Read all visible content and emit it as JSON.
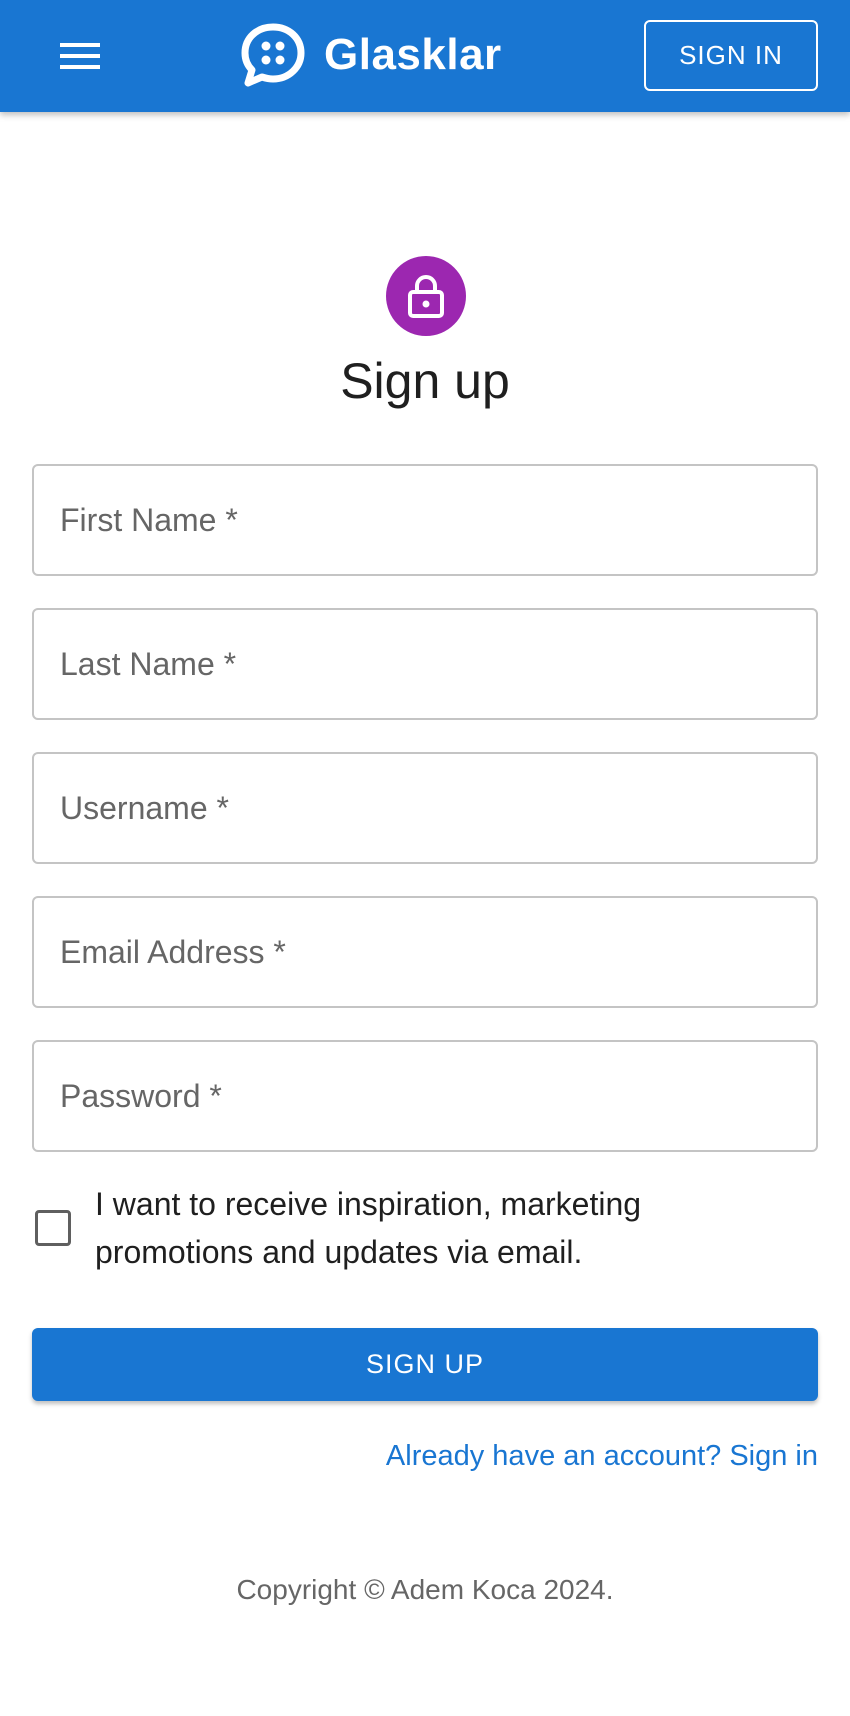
{
  "header": {
    "brand_name": "Glasklar",
    "signin_label": "SIGN IN",
    "menu_icon": "hamburger-menu-icon",
    "logo_icon": "chat-bubble-logo-icon",
    "color": "#1976d2"
  },
  "form": {
    "avatar_icon": "lock-icon",
    "avatar_color": "#9c27b0",
    "title": "Sign up",
    "fields": {
      "first_name": {
        "placeholder": "First Name *",
        "value": ""
      },
      "last_name": {
        "placeholder": "Last Name *",
        "value": ""
      },
      "username": {
        "placeholder": "Username *",
        "value": ""
      },
      "email": {
        "placeholder": "Email Address *",
        "value": ""
      },
      "password": {
        "placeholder": "Password *",
        "value": ""
      }
    },
    "marketing_checkbox": {
      "label": "I want to receive inspiration, marketing promotions and updates via email.",
      "checked": false
    },
    "submit_label": "SIGN UP",
    "signin_link": "Already have an account? Sign in"
  },
  "footer": {
    "copyright": "Copyright © Adem Koca 2024."
  }
}
